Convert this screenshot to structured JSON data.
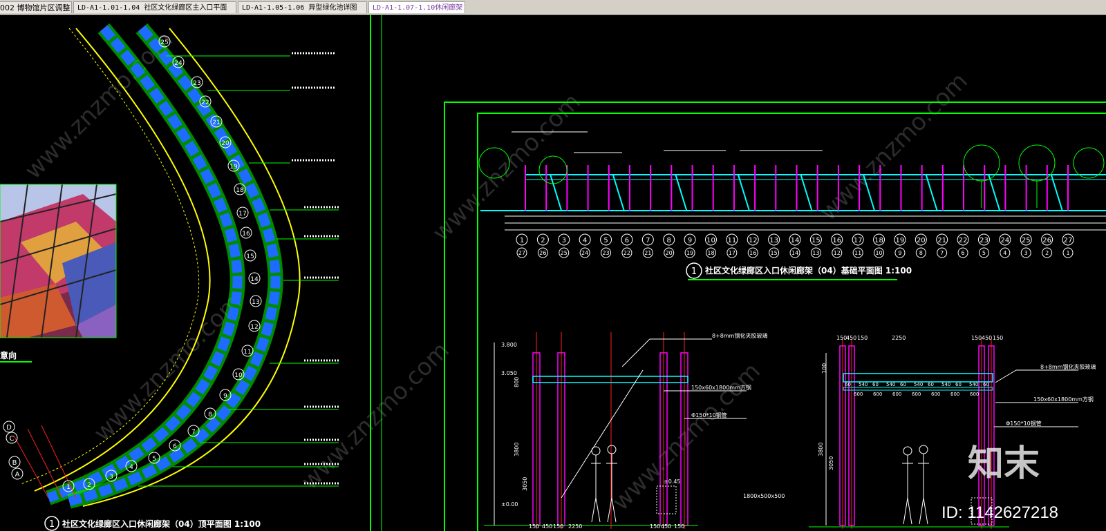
{
  "tabs": [
    {
      "label": "002 博物馆片区调整",
      "active": false
    },
    {
      "label": "LD-A1-1.01-1.04 社区文化绿廊区主入口平面",
      "active": false
    },
    {
      "label": "LD-A1-1.05-1.06 异型绿化池详图",
      "active": false
    },
    {
      "label": "LD-A1-1.07-1.10休闲廊架",
      "active": true
    }
  ],
  "drawing": {
    "left_caption_number": "1",
    "left_caption": "社区文化绿廊区入口休闲廊架（04）顶平面图 1:100",
    "right_caption_number": "1",
    "right_caption": "社区文化绿廊区入口休闲廊架（04）基础平面图 1:100",
    "image_label": "意向",
    "grid_labels_top": [
      "1",
      "2",
      "3",
      "4",
      "5",
      "6",
      "7",
      "8",
      "9",
      "10",
      "11",
      "12",
      "13",
      "14",
      "15",
      "16",
      "17",
      "18",
      "19",
      "20",
      "21",
      "22",
      "23",
      "24",
      "25",
      "26",
      "27"
    ],
    "grid_labels_bottom": [
      "27",
      "26",
      "25",
      "24",
      "23",
      "22",
      "21",
      "20",
      "19",
      "18",
      "17",
      "16",
      "15",
      "14",
      "13",
      "12",
      "11",
      "10",
      "9",
      "8",
      "7",
      "6",
      "5",
      "4",
      "3",
      "2",
      "1"
    ],
    "arc_labels": [
      "1",
      "2",
      "3",
      "4",
      "5",
      "6",
      "7",
      "8",
      "9",
      "10",
      "11",
      "12",
      "13",
      "14",
      "15",
      "16",
      "17",
      "18",
      "19",
      "20",
      "21",
      "22",
      "23",
      "24",
      "25"
    ],
    "row_labels": [
      "D",
      "C",
      "B",
      "A"
    ],
    "section_dims_1": [
      "150",
      "450",
      "150",
      "2250",
      "150",
      "450",
      "150"
    ],
    "section_dims_2": [
      "150",
      "450",
      "150",
      "2250",
      "150",
      "450",
      "150"
    ],
    "level_marks": [
      "3.800",
      "3.050",
      "±0.00"
    ],
    "level_right": "±0.45",
    "spacing_labels": [
      "60",
      "540",
      "60",
      "540",
      "60",
      "540",
      "60",
      "540",
      "60",
      "540",
      "60"
    ],
    "spacing_600": [
      "600",
      "600",
      "600",
      "600",
      "600",
      "600",
      "600"
    ],
    "annotation_main": "150x60x1800mm方钢",
    "annotation_glass": "8+8mm钢化夹胶玻璃",
    "annotation_pipe": "Φ150*10钢管",
    "annotation_foundation": "1800x500x500",
    "dim_3800": "3800",
    "dim_3050": "3050",
    "dim_800": "800",
    "dim_100": "100"
  },
  "watermark": {
    "brand": "知末",
    "id_text": "ID: 1142627218",
    "site": "www.znzmo.com"
  },
  "colors": {
    "background": "#000000",
    "tabbar": "#d4d0c8",
    "line_green": "#00ff00",
    "line_cyan": "#00ffff",
    "line_magenta": "#ff00ff",
    "line_yellow": "#ffff00",
    "fill_blue": "#1e6bff",
    "line_red": "#ff2020"
  }
}
